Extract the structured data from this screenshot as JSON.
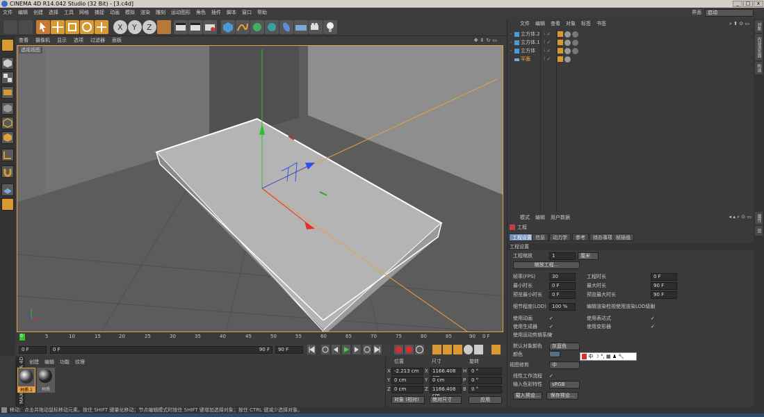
{
  "title_bar": {
    "title": "CINEMA 4D R14.042 Studio (32 Bit) - [3.c4d]",
    "minimize": "_",
    "maximize": "□",
    "close": "x"
  },
  "menu": {
    "items": [
      "文件",
      "编辑",
      "创建",
      "选择",
      "工具",
      "网格",
      "捕捉",
      "动画",
      "模拟",
      "渲染",
      "雕刻",
      "运动图形",
      "角色",
      "插件",
      "脚本",
      "窗口",
      "帮助"
    ],
    "interface_label": "界面",
    "interface_value": "启动"
  },
  "viewport": {
    "menu": [
      "查看",
      "摄像机",
      "显示",
      "选项",
      "过滤器",
      "面板"
    ],
    "label": "透视视图"
  },
  "timeline": {
    "ticks": [
      "0",
      "5",
      "10",
      "15",
      "20",
      "25",
      "30",
      "35",
      "40",
      "45",
      "50",
      "55",
      "60",
      "65",
      "70",
      "75",
      "80",
      "85",
      "90"
    ],
    "current": "0 F",
    "end_marker": "90 F"
  },
  "transport": {
    "start_field": "0 F",
    "start_field2": "0 F",
    "end_field": "90 F",
    "end_field2": "90 F"
  },
  "material_manager": {
    "menu": [
      "创建",
      "编辑",
      "功能",
      "纹理"
    ],
    "materials": [
      {
        "name": "材质.1"
      },
      {
        "name": "材质"
      }
    ]
  },
  "coordinates": {
    "headers": {
      "position": "位置",
      "size": "尺寸",
      "rotation": "旋转"
    },
    "rows": [
      {
        "axis": "X",
        "pos": "-2.213 cm",
        "size_axis": "X",
        "size": "1166.408 cm",
        "rot_axis": "H",
        "rot": "0 °"
      },
      {
        "axis": "Y",
        "pos": "0 cm",
        "size_axis": "Y",
        "size": "0 cm",
        "rot_axis": "P",
        "rot": "0 °"
      },
      {
        "axis": "Z",
        "pos": "0 cm",
        "size_axis": "Z",
        "size": "1166.408 cm",
        "rot_axis": "B",
        "rot": "0 °"
      }
    ],
    "mode": "对象 (相对)",
    "size_mode": "绝对尺寸",
    "apply": "应用"
  },
  "object_manager": {
    "menu": [
      "文件",
      "编辑",
      "查看",
      "对象",
      "标签",
      "书签"
    ],
    "objects": [
      {
        "name": "立方体.2",
        "color": "#9cc8ff"
      },
      {
        "name": "立方体.1",
        "color": "#9cc8ff"
      },
      {
        "name": "立方体",
        "color": "#9cc8ff"
      },
      {
        "name": "平面",
        "color": "#ffb040"
      }
    ]
  },
  "attributes": {
    "menu": [
      "模式",
      "编辑",
      "用户数据"
    ],
    "title": "工程",
    "tabs": [
      "工程设置",
      "信息",
      "动力学",
      "参考",
      "待办事项",
      "帧插值"
    ],
    "section": "工程设置",
    "scale_label": "工程缩放",
    "scale_value": "1",
    "scale_unit": "厘米",
    "scale_button": "缩放工程...",
    "fps_label": "帧率(FPS)",
    "fps": "30",
    "project_time_label": "工程时长",
    "project_time": "0 F",
    "min_time_label": "最小时长",
    "min_time": "0 F",
    "max_time_label": "最大时长",
    "max_time": "90 F",
    "preview_min_label": "预览最小时长",
    "preview_min": "0 F",
    "preview_max_label": "预览最大时长",
    "preview_max": "90 F",
    "lod_label": "细节程度(LOD)",
    "lod": "100 %",
    "render_lod_label": "编辑渲染检视使用渲染LOD级别",
    "use_anim": "使用动画",
    "use_expr": "使用表达式",
    "use_gen": "使用生成器",
    "use_deform": "使用变形器",
    "use_mograph": "使用运动剪辑系统",
    "default_color_label": "默认对象颜色",
    "default_color": "灰蓝色",
    "color_label": "颜色",
    "view_clip_label": "视图修剪",
    "view_clip": "中",
    "linear_label": "线性工作流程",
    "input_color_label": "输入色彩特性",
    "input_color": "sRGB",
    "load_preset": "载入预设...",
    "save_preset": "保存预设..."
  },
  "right_tabs": [
    "对象",
    "内容浏览器",
    "构造",
    "属性",
    "层"
  ],
  "ime": {
    "items": [
      "中",
      "☽",
      "°,",
      "▦",
      "♟",
      "🔧"
    ]
  },
  "status": "移动：点击并拖动鼠标移动元素。按住 SHIFT 键量化移动；节点编辑模式时按住 SHIFT 键增加选择对象；按住 CTRL 键减少选择对象。"
}
